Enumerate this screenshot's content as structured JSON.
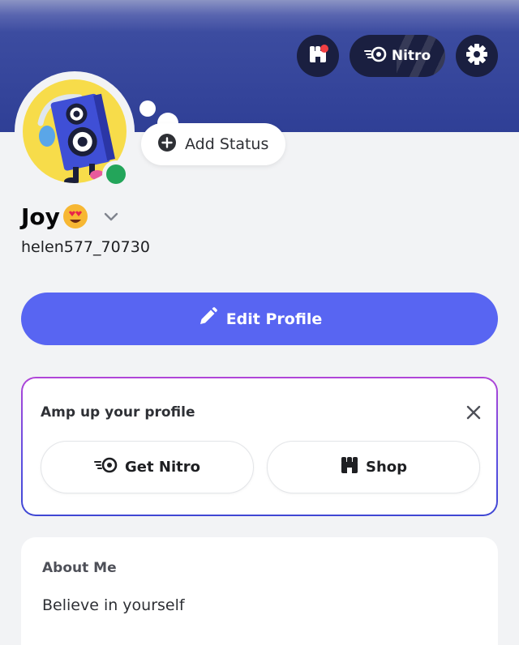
{
  "header": {
    "nitro_label": "Nitro"
  },
  "status": {
    "add_status_label": "Add Status"
  },
  "profile": {
    "display_name": "Joy",
    "username": "helen577_70730",
    "online_status_color": "#23a55a"
  },
  "actions": {
    "edit_profile_label": "Edit Profile"
  },
  "promo": {
    "title": "Amp up your profile",
    "get_nitro_label": "Get Nitro",
    "shop_label": "Shop"
  },
  "about": {
    "title": "About Me",
    "text": "Believe in yourself"
  },
  "colors": {
    "accent": "#5865f2",
    "banner": "#2f3f96",
    "online": "#23a55a"
  }
}
